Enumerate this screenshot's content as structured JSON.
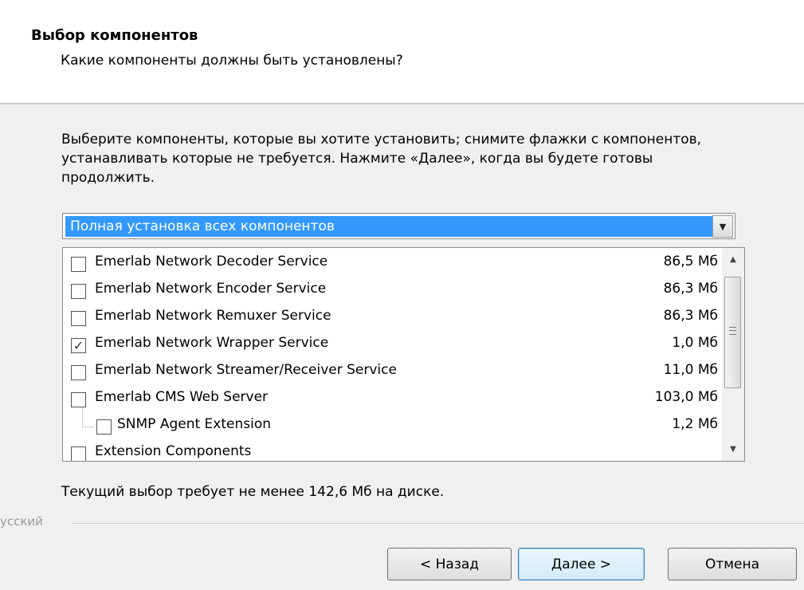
{
  "header": {
    "title": "Выбор компонентов",
    "subtitle": "Какие компоненты должны быть установлены?"
  },
  "description": "Выберите компоненты, которые вы хотите установить; снимите флажки с компонентов, устанавливать которые не требуется. Нажмите «Далее», когда вы будете готовы продолжить.",
  "install_type": {
    "selected": "Полная установка всех компонентов"
  },
  "components": [
    {
      "label": "Emerlab Network Decoder Service",
      "size": "86,5 Мб",
      "checked": false
    },
    {
      "label": "Emerlab Network Encoder Service",
      "size": "86,3 Мб",
      "checked": false
    },
    {
      "label": "Emerlab Network Remuxer Service",
      "size": "86,3 Мб",
      "checked": false
    },
    {
      "label": "Emerlab Network Wrapper Service",
      "size": "1,0 Мб",
      "checked": true
    },
    {
      "label": "Emerlab Network Streamer/Receiver Service",
      "size": "11,0 Мб",
      "checked": false
    },
    {
      "label": "Emerlab CMS Web Server",
      "size": "103,0 Мб",
      "checked": false
    },
    {
      "label": "SNMP Agent Extension",
      "size": "1,2 Мб",
      "checked": false,
      "child": true
    },
    {
      "label": "Extension Components",
      "size": "",
      "checked": false
    }
  ],
  "space_note": "Текущий выбор требует не менее 142,6 Мб на диске.",
  "language_label": "усский",
  "buttons": {
    "back": "< Назад",
    "next": "Далее >",
    "cancel": "Отмена"
  },
  "icons": {
    "checkmark": "check-icon",
    "dropdown": "chevron-down-icon",
    "scroll_up": "scroll-up-icon",
    "scroll_down": "scroll-down-icon"
  }
}
